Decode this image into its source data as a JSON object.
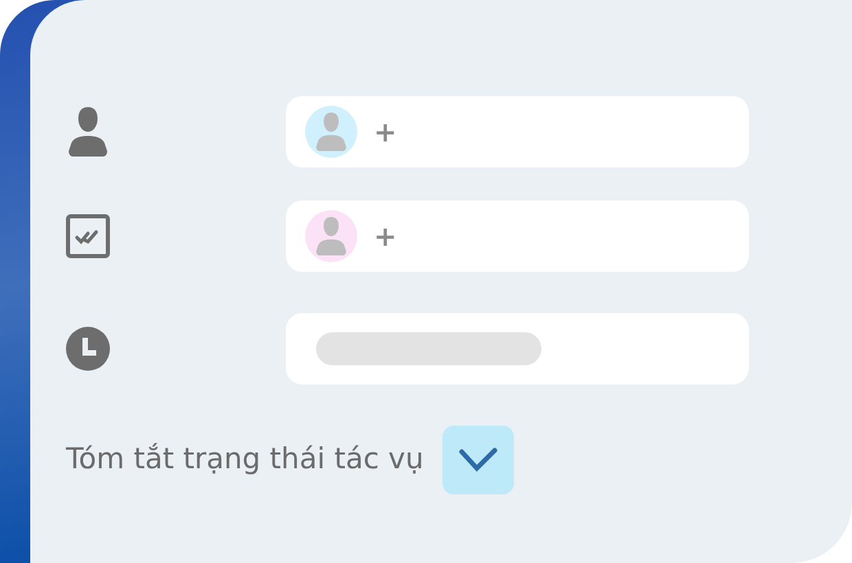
{
  "rows": [
    {
      "kind": "person",
      "avatar": {
        "color": "#cff0fc"
      },
      "add": "+"
    },
    {
      "kind": "review",
      "avatar": {
        "color": "#fce2f6"
      },
      "add": "+"
    },
    {
      "kind": "time"
    }
  ],
  "summary": {
    "label": "Tóm tắt trạng thái tác vụ",
    "checked": true
  }
}
